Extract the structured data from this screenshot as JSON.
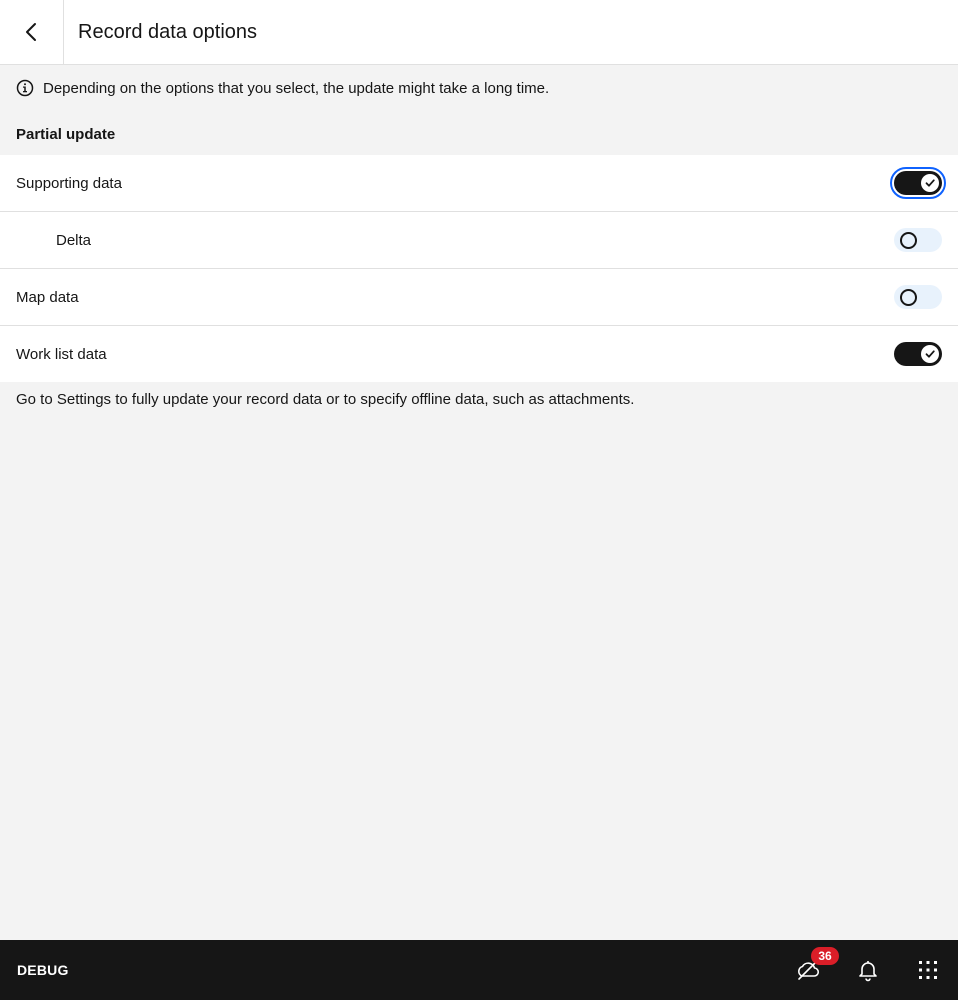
{
  "header": {
    "title": "Record data options",
    "back_icon": "chevron-left-icon"
  },
  "info": {
    "icon": "information-icon",
    "text": "Depending on the options that you select, the update might take a long time."
  },
  "section": {
    "title": "Partial update"
  },
  "options": [
    {
      "label": "Supporting data",
      "checked": true,
      "focused": true,
      "indent": false
    },
    {
      "label": "Delta",
      "checked": false,
      "focused": false,
      "indent": true
    },
    {
      "label": "Map data",
      "checked": false,
      "focused": false,
      "indent": false
    },
    {
      "label": "Work list data",
      "checked": true,
      "focused": false,
      "indent": false
    }
  ],
  "footer_note": "Go to Settings to fully update your record data or to specify offline data, such as attachments.",
  "bottom_bar": {
    "mode_label": "DEBUG",
    "sync_badge": "36",
    "icons": [
      "offline-sync-icon",
      "notification-bell-icon",
      "app-switcher-icon"
    ]
  },
  "colors": {
    "toggle_on": "#161616",
    "toggle_off": "#e8f2fc",
    "focus_ring": "#0f62fe",
    "badge": "#da1e28",
    "bottom_bar": "#161616",
    "page_bg": "#f3f3f3"
  }
}
